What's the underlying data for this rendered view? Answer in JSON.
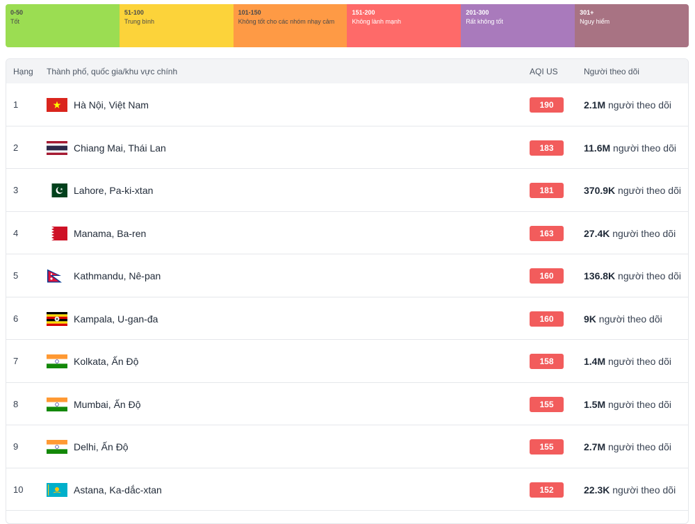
{
  "legend": [
    {
      "range": "0-50",
      "label": "Tốt",
      "color": "#9bdd52"
    },
    {
      "range": "51-100",
      "label": "Trung bình",
      "color": "#fcd33a"
    },
    {
      "range": "101-150",
      "label": "Không tốt cho các nhóm nhạy cảm",
      "color": "#fe9a45"
    },
    {
      "range": "151-200",
      "label": "Không lành mạnh",
      "color": "#fe6a69"
    },
    {
      "range": "201-300",
      "label": "Rất không tốt",
      "color": "#a97abc"
    },
    {
      "range": "301+",
      "label": "Nguy hiểm",
      "color": "#a87383"
    }
  ],
  "table": {
    "headers": {
      "rank": "Hạng",
      "city": "Thành phố, quốc gia/khu vực chính",
      "aqi": "AQI US",
      "followers": "Người theo dõi"
    },
    "followers_suffix": "người theo dõi",
    "badge_color": "#f25c5c",
    "rows": [
      {
        "rank": "1",
        "city": "Hà Nội, Việt Nam",
        "flag": "vietnam-flag-icon",
        "aqi": "190",
        "followers": "2.1M"
      },
      {
        "rank": "2",
        "city": "Chiang Mai, Thái Lan",
        "flag": "thailand-flag-icon",
        "aqi": "183",
        "followers": "11.6M"
      },
      {
        "rank": "3",
        "city": "Lahore, Pa-ki-xtan",
        "flag": "pakistan-flag-icon",
        "aqi": "181",
        "followers": "370.9K"
      },
      {
        "rank": "4",
        "city": "Manama, Ba-ren",
        "flag": "bahrain-flag-icon",
        "aqi": "163",
        "followers": "27.4K"
      },
      {
        "rank": "5",
        "city": "Kathmandu, Nê-pan",
        "flag": "nepal-flag-icon",
        "aqi": "160",
        "followers": "136.8K"
      },
      {
        "rank": "6",
        "city": "Kampala, U-gan-đa",
        "flag": "uganda-flag-icon",
        "aqi": "160",
        "followers": "9K"
      },
      {
        "rank": "7",
        "city": "Kolkata, Ấn Độ",
        "flag": "india-flag-icon",
        "aqi": "158",
        "followers": "1.4M"
      },
      {
        "rank": "8",
        "city": "Mumbai, Ấn Độ",
        "flag": "india-flag-icon",
        "aqi": "155",
        "followers": "1.5M"
      },
      {
        "rank": "9",
        "city": "Delhi, Ấn Độ",
        "flag": "india-flag-icon",
        "aqi": "155",
        "followers": "2.7M"
      },
      {
        "rank": "10",
        "city": "Astana, Ka-dắc-xtan",
        "flag": "kazakhstan-flag-icon",
        "aqi": "152",
        "followers": "22.3K"
      }
    ]
  }
}
